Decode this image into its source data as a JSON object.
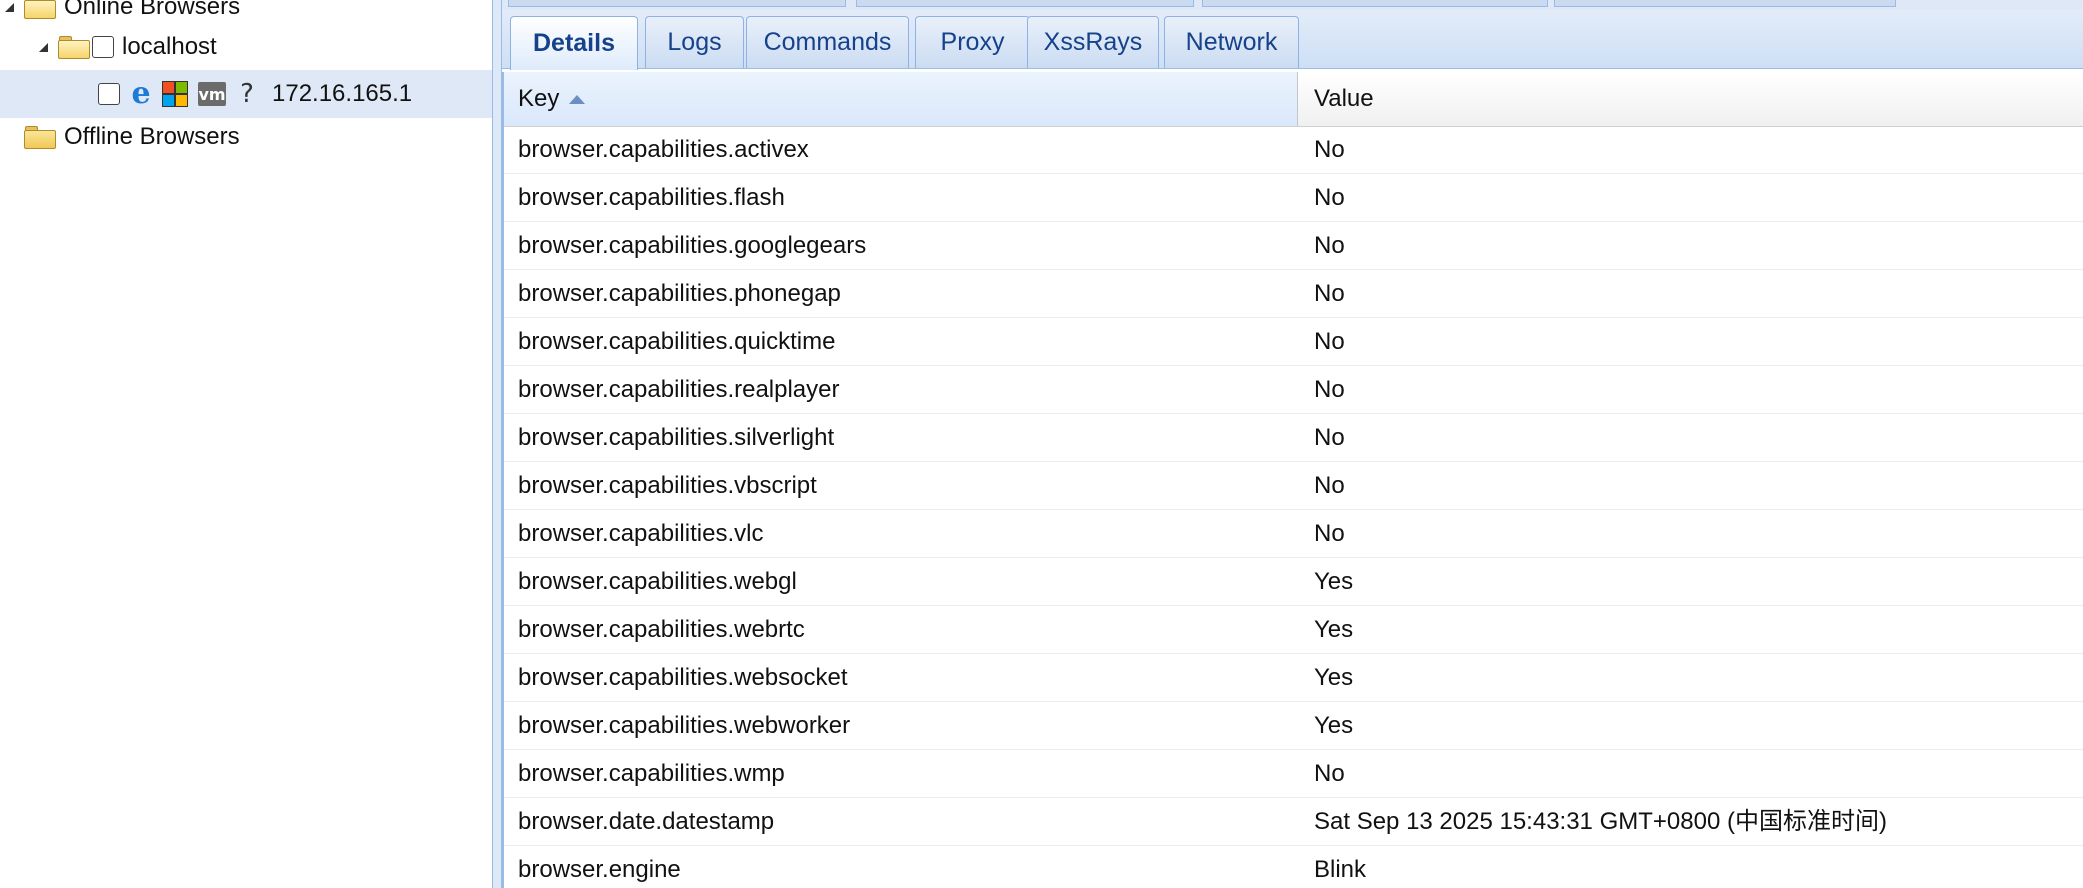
{
  "tree": {
    "online_label": "Online Browsers",
    "host_label": "localhost",
    "browser_label": "172.16.165.1",
    "vm_text": "vm",
    "unknown_text": "?",
    "offline_label": "Offline Browsers",
    "icons": {
      "browser": "internet-explorer-icon",
      "os": "windows-icon",
      "hardware": "vmware-icon",
      "unknown": "question-icon"
    }
  },
  "tabs": [
    {
      "label": "Details",
      "active": true
    },
    {
      "label": "Logs",
      "active": false
    },
    {
      "label": "Commands",
      "active": false
    },
    {
      "label": "Proxy",
      "active": false
    },
    {
      "label": "XssRays",
      "active": false
    },
    {
      "label": "Network",
      "active": false
    }
  ],
  "grid": {
    "columns": {
      "key": "Key",
      "value": "Value"
    },
    "sort": "key-ascending",
    "rows": [
      {
        "key": "browser.capabilities.activex",
        "value": "No"
      },
      {
        "key": "browser.capabilities.flash",
        "value": "No"
      },
      {
        "key": "browser.capabilities.googlegears",
        "value": "No"
      },
      {
        "key": "browser.capabilities.phonegap",
        "value": "No"
      },
      {
        "key": "browser.capabilities.quicktime",
        "value": "No"
      },
      {
        "key": "browser.capabilities.realplayer",
        "value": "No"
      },
      {
        "key": "browser.capabilities.silverlight",
        "value": "No"
      },
      {
        "key": "browser.capabilities.vbscript",
        "value": "No"
      },
      {
        "key": "browser.capabilities.vlc",
        "value": "No"
      },
      {
        "key": "browser.capabilities.webgl",
        "value": "Yes"
      },
      {
        "key": "browser.capabilities.webrtc",
        "value": "Yes"
      },
      {
        "key": "browser.capabilities.websocket",
        "value": "Yes"
      },
      {
        "key": "browser.capabilities.webworker",
        "value": "Yes"
      },
      {
        "key": "browser.capabilities.wmp",
        "value": "No"
      },
      {
        "key": "browser.date.datestamp",
        "value": "Sat Sep 13 2025 15:43:31 GMT+0800 (中国标准时间)"
      },
      {
        "key": "browser.engine",
        "value": "Blink"
      }
    ]
  },
  "colors": {
    "accent": "#15428b",
    "selection": "#dfe8f6",
    "border": "#99bbe8"
  }
}
